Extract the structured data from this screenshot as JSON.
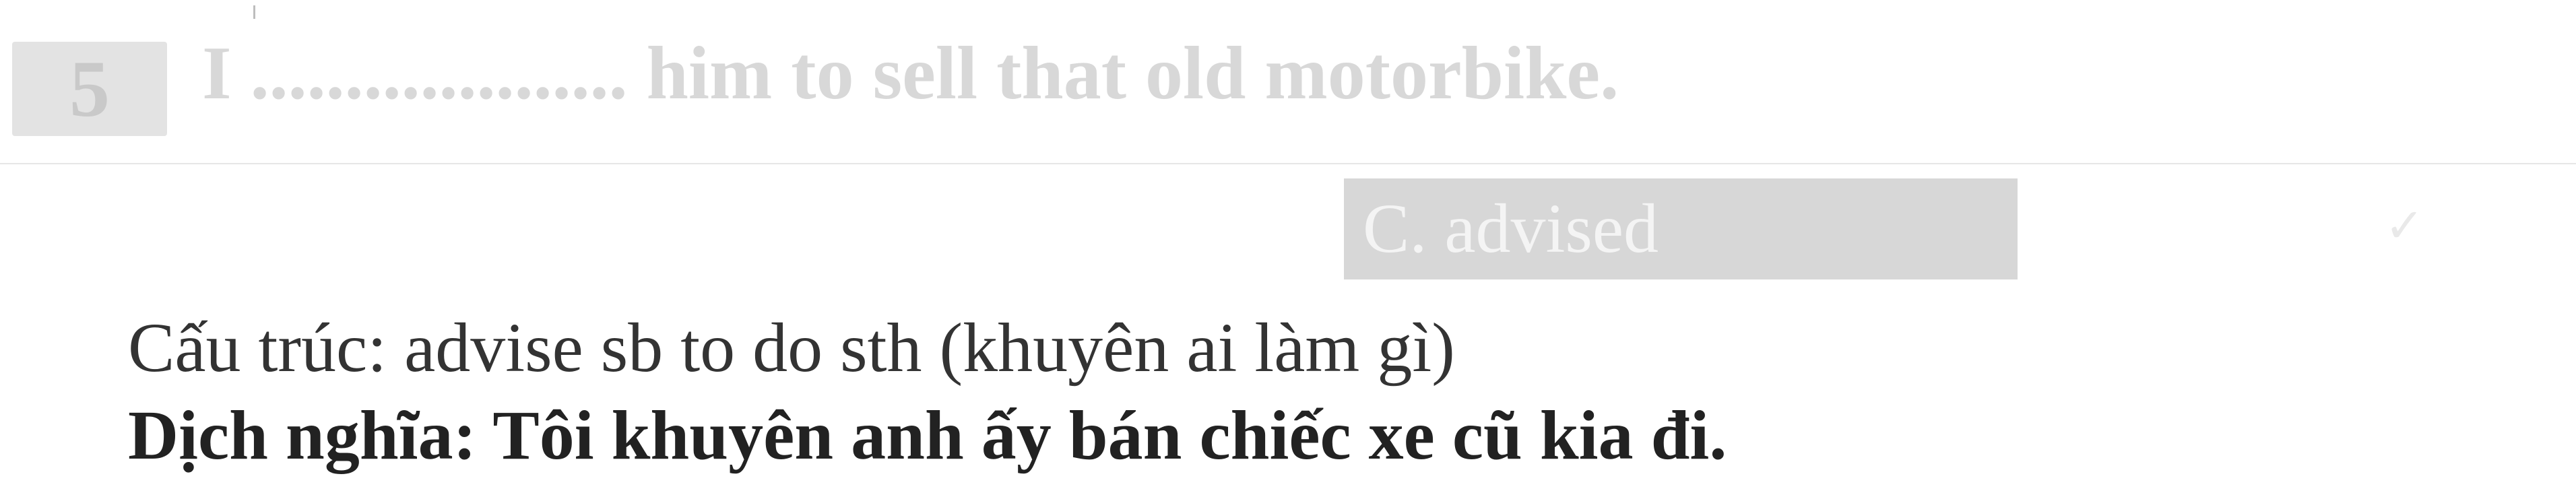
{
  "question": {
    "number": "5",
    "text": "I .................... him to sell that old motorbike."
  },
  "answer": {
    "label": "C. advised",
    "mark": "✓"
  },
  "explanation": {
    "structure": "Cấu trúc: advise sb to do sth (khuyên ai làm gì)",
    "translation": "Dịch nghĩa: Tôi khuyên anh ấy bán chiếc xe cũ kia đi."
  },
  "colors": {
    "faded_text": "#d8d8d8",
    "option_background": "#d7d7d7",
    "body_text": "#333333"
  }
}
